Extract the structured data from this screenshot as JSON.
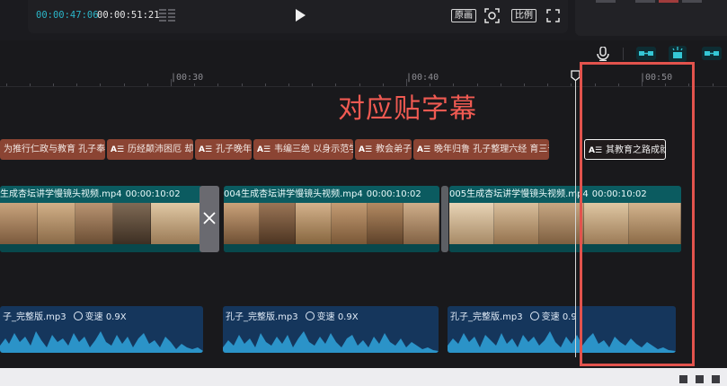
{
  "player": {
    "current_time": "00:00:47:06",
    "total_time": "00:00:51:21",
    "original_label": "原画",
    "ratio_label": "比例",
    "icons": [
      "grid-icon",
      "play-icon",
      "focus-icon",
      "fullscreen-icon"
    ]
  },
  "toolbar": {
    "icons": [
      "microphone-icon",
      "link-clip-icon",
      "snap-icon",
      "link-track-icon"
    ]
  },
  "ruler": {
    "labels": [
      "|00:30",
      "|00:40",
      "|00:50"
    ]
  },
  "annotation": {
    "text": "对应贴字幕",
    "color": "#f05a52"
  },
  "subtitle_track": {
    "tag": "A☰",
    "clips": [
      {
        "text": "为推行仁政与教育 孔子奉"
      },
      {
        "text": "历经颠沛困厄 却"
      },
      {
        "text": "孔子晚年"
      },
      {
        "text": "韦编三绝 以身示范学"
      },
      {
        "text": "教会弟子"
      },
      {
        "text": "晚年归鲁 孔子整理六经 育三千"
      },
      {
        "text": "其教育之路成就",
        "selected": true
      }
    ]
  },
  "video_track": {
    "clips": [
      {
        "name": "生成杏坛讲学慢镜头视频.mp4",
        "duration": "00:00:10:02"
      },
      {
        "name": "004生成杏坛讲学慢镜头视频.mp4",
        "duration": "00:00:10:02"
      },
      {
        "name": "005生成杏坛讲学慢镜头视频.mp4",
        "duration": "00:00:10:02"
      }
    ]
  },
  "audio_track": {
    "clips": [
      {
        "name": "子_完整版.mp3",
        "speed": "变速 0.9X"
      },
      {
        "name": "孔子_完整版.mp3",
        "speed": "变速 0.9X"
      },
      {
        "name": "孔子_完整版.mp3",
        "speed": "变速 0.9"
      }
    ]
  },
  "colors": {
    "accent": "#2bb5c8",
    "subtitle_clip": "#8b4433",
    "video_clip": "#0b5b60",
    "audio_clip": "#15365c",
    "highlight": "#e2534d"
  }
}
